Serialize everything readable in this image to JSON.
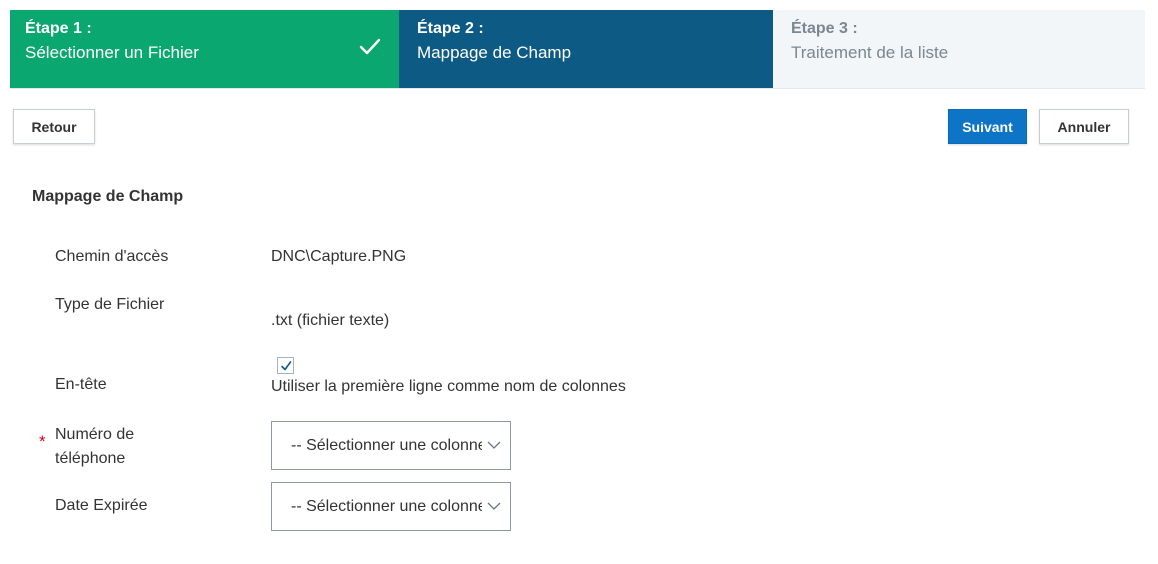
{
  "stepper": {
    "steps": [
      {
        "num": "Étape 1 :",
        "label": "Sélectionner un Fichier",
        "status": "completed"
      },
      {
        "num": "Étape 2 :",
        "label": "Mappage de Champ",
        "status": "active"
      },
      {
        "num": "Étape 3 :",
        "label": "Traitement de la liste",
        "status": "pending"
      }
    ]
  },
  "toolbar": {
    "back_label": "Retour",
    "next_label": "Suivant",
    "cancel_label": "Annuler"
  },
  "form": {
    "title": "Mappage de Champ",
    "path_label": "Chemin d'accès",
    "path_value": "DNC\\Capture.PNG",
    "file_type_label": "Type de Fichier",
    "file_type_value": ".txt (fichier texte)",
    "header_label": "En-tête",
    "header_checked": true,
    "header_option": "Utiliser la première ligne comme nom de colonnes",
    "phone_label_line1": "Numéro de",
    "phone_label_line2": "téléphone",
    "phone_required_mark": "*",
    "phone_select": "-- Sélectionner une colonne --",
    "expiry_label": "Date Expirée",
    "expiry_select": "-- Sélectionner une colonne --"
  },
  "colors": {
    "step_completed": "#0aa770",
    "step_active": "#0d5a84",
    "step_pending": "#f2f6f8",
    "primary_button": "#0d74c6",
    "required": "#d0021b"
  }
}
